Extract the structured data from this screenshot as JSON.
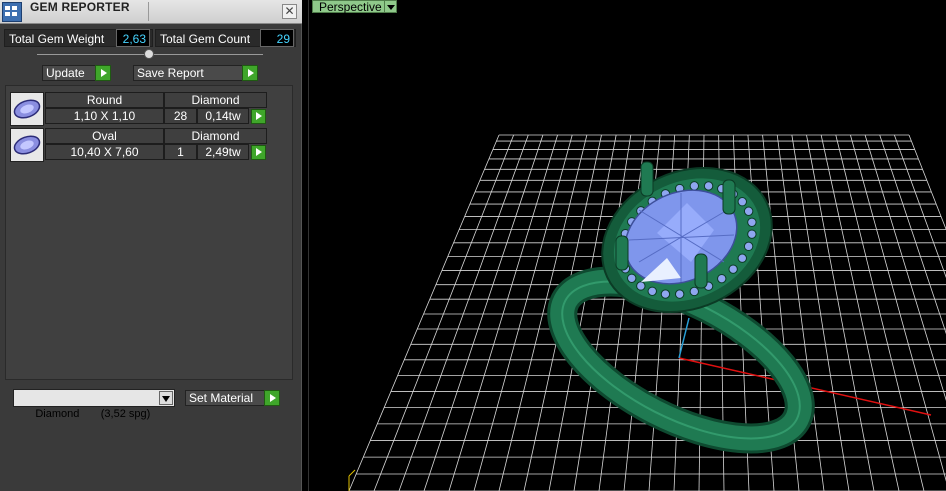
{
  "panel": {
    "title": "GEM REPORTER",
    "close_glyph": "✕",
    "total_weight_label": "Total Gem Weight",
    "total_weight_value": "2,63",
    "total_count_label": "Total Gem Count",
    "total_count_value": "29",
    "update_label": "Update",
    "save_report_label": "Save Report",
    "gems": [
      {
        "shape": "Round",
        "type": "Diamond",
        "size": "1,10 X 1,10",
        "count": "28",
        "weight": "0,14tw"
      },
      {
        "shape": "Oval",
        "type": "Diamond",
        "size": "10,40 X 7,60",
        "count": "1",
        "weight": "2,49tw"
      }
    ],
    "material_value": "Diamond       (3,52 spg)",
    "set_material_label": "Set Material"
  },
  "viewport": {
    "view_label": "Perspective"
  },
  "colors": {
    "metal": "#1f7a52",
    "gem": "#8fa6f0",
    "grid": "#d8d8d8",
    "accent_value": "#46d4ff",
    "go_button": "#3fa62a"
  }
}
